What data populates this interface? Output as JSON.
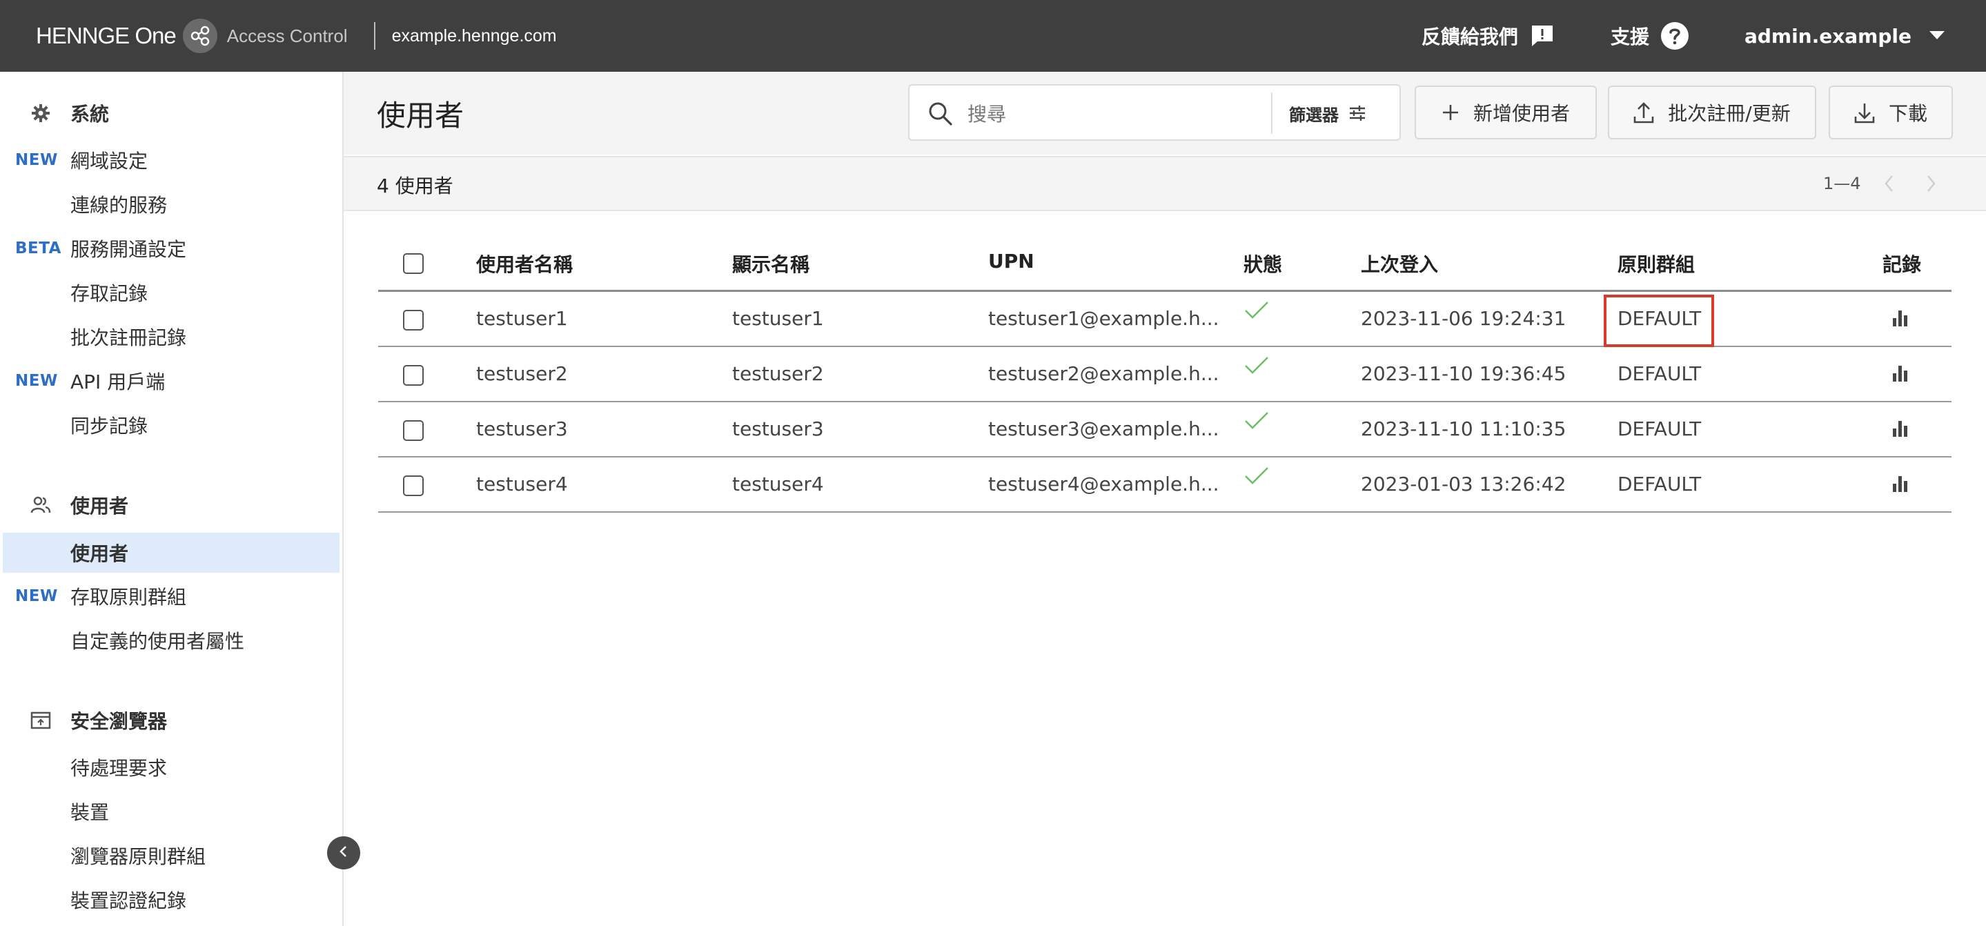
{
  "header": {
    "brand": "HENNGE One",
    "product": "Access Control",
    "domain": "example.hennge.com",
    "feedback_label": "反饋給我們",
    "support_label": "支援",
    "account_label": "admin.example"
  },
  "sidebar": {
    "sections": [
      {
        "title": "系統",
        "icon": "gear-icon",
        "items": [
          {
            "badge": "NEW",
            "label": "網域設定"
          },
          {
            "badge": "",
            "label": "連線的服務"
          },
          {
            "badge": "BETA",
            "label": "服務開通設定"
          },
          {
            "badge": "",
            "label": "存取記錄"
          },
          {
            "badge": "",
            "label": "批次註冊記錄"
          },
          {
            "badge": "NEW",
            "label": "API 用戶端"
          },
          {
            "badge": "",
            "label": "同步記錄"
          }
        ]
      },
      {
        "title": "使用者",
        "icon": "users-icon",
        "items": [
          {
            "badge": "",
            "label": "使用者",
            "active": true
          },
          {
            "badge": "NEW",
            "label": "存取原則群組"
          },
          {
            "badge": "",
            "label": "自定義的使用者屬性"
          }
        ]
      },
      {
        "title": "安全瀏覽器",
        "icon": "browser-icon",
        "items": [
          {
            "badge": "",
            "label": "待處理要求"
          },
          {
            "badge": "",
            "label": "裝置"
          },
          {
            "badge": "",
            "label": "瀏覽器原則群組"
          },
          {
            "badge": "",
            "label": "裝置認證紀錄"
          }
        ]
      }
    ]
  },
  "main": {
    "title": "使用者",
    "search_placeholder": "搜尋",
    "filter_label": "篩選器",
    "add_user_label": "新增使用者",
    "batch_label": "批次註冊/更新",
    "download_label": "下載",
    "count_text": "4 使用者",
    "pager_range": "1—4"
  },
  "table": {
    "columns": [
      "使用者名稱",
      "顯示名稱",
      "UPN",
      "狀態",
      "上次登入",
      "原則群組",
      "記錄"
    ],
    "rows": [
      {
        "username": "testuser1",
        "display": "testuser1",
        "upn": "testuser1@example.h...",
        "status": "active",
        "last_login": "2023-11-06 19:24:31",
        "group": "DEFAULT"
      },
      {
        "username": "testuser2",
        "display": "testuser2",
        "upn": "testuser2@example.h...",
        "status": "active",
        "last_login": "2023-11-10 19:36:45",
        "group": "DEFAULT"
      },
      {
        "username": "testuser3",
        "display": "testuser3",
        "upn": "testuser3@example.h...",
        "status": "active",
        "last_login": "2023-11-10 11:10:35",
        "group": "DEFAULT"
      },
      {
        "username": "testuser4",
        "display": "testuser4",
        "upn": "testuser4@example.h...",
        "status": "active",
        "last_login": "2023-01-03 13:26:42",
        "group": "DEFAULT"
      }
    ]
  },
  "colors": {
    "header_bg": "#3f3f3f",
    "badge": "#2f6ec6",
    "active_item_bg": "#dfeafb",
    "status_check": "#6cc26c",
    "highlight": "#d93a2b"
  }
}
